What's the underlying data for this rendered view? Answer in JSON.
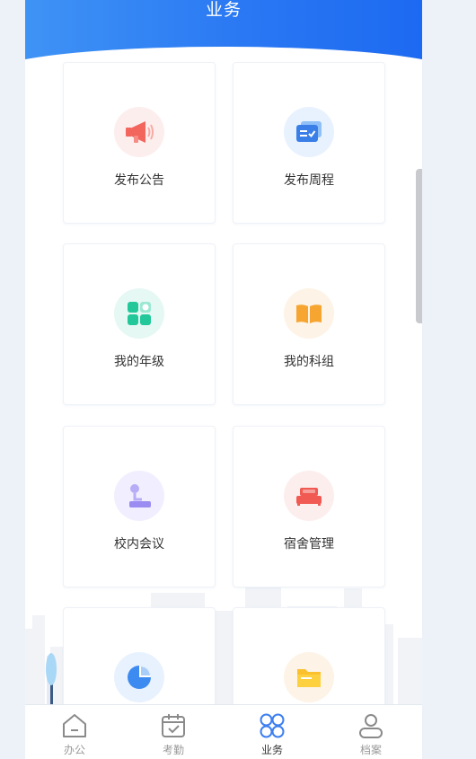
{
  "header": {
    "title": "业务"
  },
  "cards": [
    {
      "label": "发布公告",
      "icon": "megaphone-icon",
      "bg": "#fdeeee",
      "color": "#f2665e"
    },
    {
      "label": "发布周程",
      "icon": "schedule-card-icon",
      "bg": "#e8f2fe",
      "color": "#3a7fe8"
    },
    {
      "label": "我的年级",
      "icon": "grade-grid-icon",
      "bg": "#e5f8f3",
      "color": "#22c79a"
    },
    {
      "label": "我的科组",
      "icon": "open-book-icon",
      "bg": "#fdf3e6",
      "color": "#f7a531"
    },
    {
      "label": "校内会议",
      "icon": "microphone-icon",
      "bg": "#f1efff",
      "color": "#9a8cf0"
    },
    {
      "label": "宿舍管理",
      "icon": "bed-icon",
      "bg": "#fdeeee",
      "color": "#f05a52"
    },
    {
      "label": "",
      "icon": "pie-chart-icon",
      "bg": "#e8f2fe",
      "color": "#3d8af0"
    },
    {
      "label": "",
      "icon": "folder-icon",
      "bg": "#fdf3e6",
      "color": "#fbc02d"
    }
  ],
  "tabbar": {
    "items": [
      {
        "label": "办公",
        "icon": "home-icon"
      },
      {
        "label": "考勤",
        "icon": "calendar-check-icon"
      },
      {
        "label": "业务",
        "icon": "four-circles-icon",
        "active": true
      },
      {
        "label": "档案",
        "icon": "user-icon"
      }
    ]
  },
  "colors": {
    "primary": "#2a78f3",
    "tab_active": "#3d7ff1",
    "tab_inactive": "#9a9a9a"
  }
}
